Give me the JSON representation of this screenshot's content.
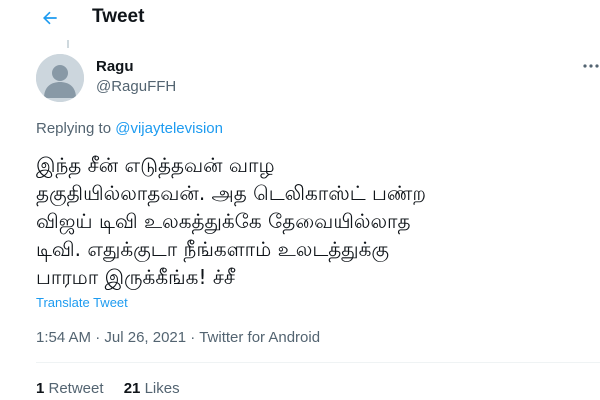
{
  "header": {
    "title": "Tweet",
    "back_icon": "arrow-left-icon",
    "accent_color": "#1d9bf0"
  },
  "author": {
    "display_name": "Ragu",
    "handle": "@RaguFFH",
    "avatar_icon": "default-avatar-icon"
  },
  "more_icon": "more-options-icon",
  "replying": {
    "prefix": "Replying to ",
    "mention": "@vijaytelevision"
  },
  "tweet": {
    "lines": [
      "இந்த சீன் எடுத்தவன் வாழ",
      "தகுதியில்லாதவன். அத டெலிகாஸ்ட் பண்ற",
      "விஜய் டிவி உலகத்துக்கே தேவையில்லாத",
      "டிவி. எதுக்குடா நீங்களாம் உலடத்துக்கு",
      "பாரமா இருக்கீங்க! ச்சீ"
    ]
  },
  "translate_label": "Translate Tweet",
  "meta": {
    "time": "1:54 AM",
    "separator": " · ",
    "date": "Jul 26, 2021",
    "source": "Twitter for Android"
  },
  "stats": {
    "retweets_count": "1",
    "retweets_label": " Retweet",
    "likes_count": "21",
    "likes_label": " Likes"
  }
}
